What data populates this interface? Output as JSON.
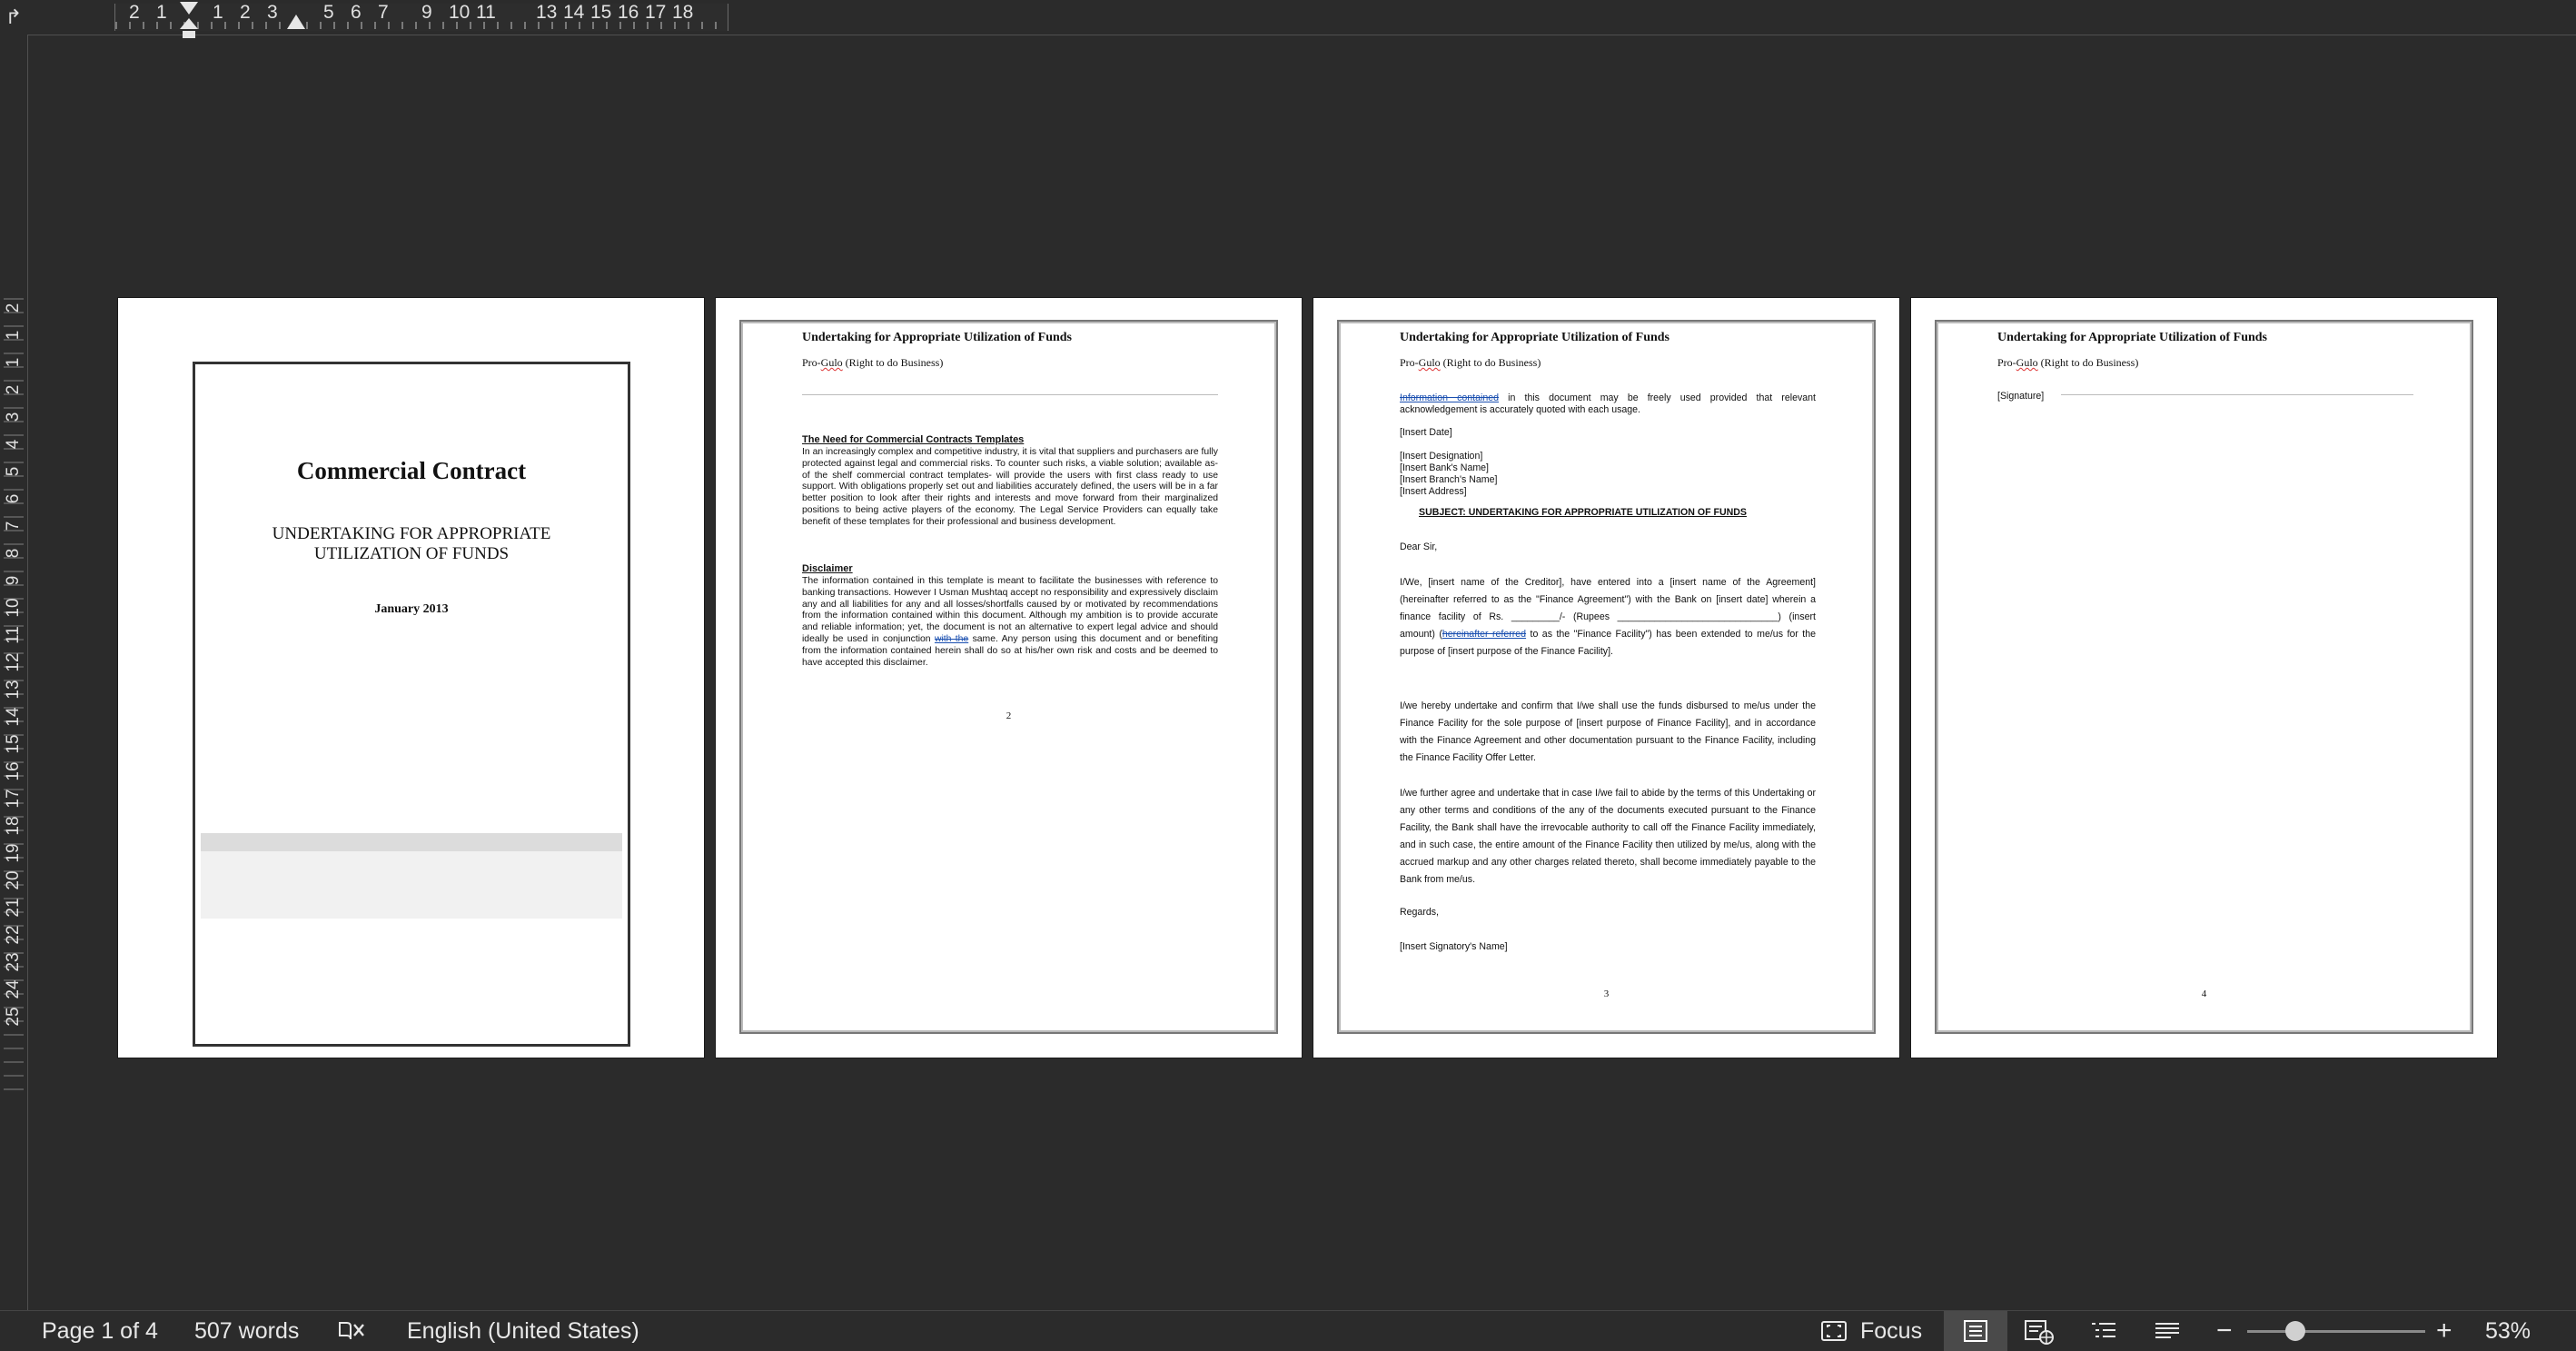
{
  "ruler": {
    "corner_icon": "tab-stop-icon",
    "top_numbers": [
      "2",
      "1",
      "1",
      "2",
      "3",
      "5",
      "6",
      "7",
      "9",
      "10",
      "11",
      "13",
      "14",
      "15",
      "16",
      "17",
      "18"
    ],
    "left_numbers": [
      "2",
      "1",
      "1",
      "2",
      "3",
      "4",
      "5",
      "6",
      "7",
      "8",
      "9",
      "10",
      "11",
      "12",
      "13",
      "14",
      "15",
      "16",
      "17",
      "18",
      "19",
      "20",
      "21",
      "22",
      "23",
      "24",
      "25"
    ]
  },
  "pages": {
    "cover": {
      "title": "Commercial Contract",
      "subtitle": "UNDERTAKING FOR APPROPRIATE\nUTILIZATION OF FUNDS",
      "date": "January 2013"
    },
    "header": {
      "title": "Undertaking for Appropriate Utilization of Funds",
      "sub_prefix": "Pro-",
      "sub_squiggle": "Gulo",
      "sub_suffix": " (Right to do Business)"
    },
    "page2": {
      "heading1": "The Need for Commercial Contracts Templates",
      "para1": "In an increasingly complex and competitive industry, it is vital that suppliers and purchasers are fully protected against legal and commercial risks. To counter such risks, a viable solution; available as- of the shelf commercial contract templates- will provide the users with first class ready to use support. With obligations properly set out and liabilities accurately defined, the users will be in a far better position to look after their rights and interests and move forward from their marginalized positions to being active players of the economy. The Legal Service Providers can equally take benefit of these templates for their professional and business development.",
      "heading2": "Disclaimer",
      "para2_a": "The information contained in this template is meant to facilitate the businesses with reference to banking transactions. However I Usman Mushtaq accept no responsibility and expressively disclaim any and all liabilities for any and all losses/shortfalls caused by or motivated by recommendations from the information contained within this document. Although my ambition is to provide accurate and reliable information; yet, the document is not an alternative to expert legal advice and should ideally be used in conjunction ",
      "para2_link": "with  the",
      "para2_b": " same. Any person using this document and or benefiting from the information contained herein shall do so at his/her own risk and costs and be deemed to have accepted this disclaimer.",
      "page_number": "2"
    },
    "page3": {
      "top_link": "Information  contained",
      "top_rest": " in this document may be freely used provided that relevant acknowledgement is accurately quoted with each usage.",
      "insert_date": "[Insert Date]",
      "addr1": "[Insert Designation]",
      "addr2": "[Insert Bank's Name]",
      "addr3": "[Insert Branch's Name]",
      "addr4": "[Insert Address]",
      "subject": "SUBJECT: UNDERTAKING FOR APPROPRIATE UTILIZATION OF FUNDS",
      "salutation": "Dear Sir,",
      "para1_a": "I/We, [insert name of the Creditor], have entered into a [insert name of the Agreement] (hereinafter referred to as the \"Finance Agreement\") with the Bank on [insert date] wherein a finance facility of Rs. _________/- (Rupees ______________________________) (insert amount) (",
      "para1_link": "hereinafter  referred",
      "para1_b": " to as the \"Finance Facility\") has been extended to me/us for the purpose of [insert purpose of the Finance Facility].",
      "para2": "I/we hereby undertake and confirm that I/we shall use the funds disbursed to me/us under the Finance Facility for the sole purpose of [insert purpose of Finance Facility], and in accordance with the Finance Agreement and other documentation pursuant to the Finance Facility, including the Finance Facility Offer Letter.",
      "para3": "I/we further agree and undertake that in case I/we fail to abide by the terms of this Undertaking or any other terms and conditions of the any of the documents executed pursuant to the Finance Facility, the Bank shall have the irrevocable authority to call off the Finance Facility immediately, and in such case, the entire amount of the Finance Facility then utilized by me/us, along with the accrued markup and any other charges related thereto, shall become immediately payable to the Bank from me/us.",
      "regards": "Regards,",
      "signatory": "[Insert Signatory's Name]",
      "page_number": "3"
    },
    "page4": {
      "signature": "[Signature]",
      "page_number": "4"
    }
  },
  "statusbar": {
    "page_info": "Page 1 of 4",
    "word_count": "507 words",
    "language": "English (United States)",
    "focus_label": "Focus",
    "zoom": "53%",
    "zoom_fraction": 0.27
  }
}
